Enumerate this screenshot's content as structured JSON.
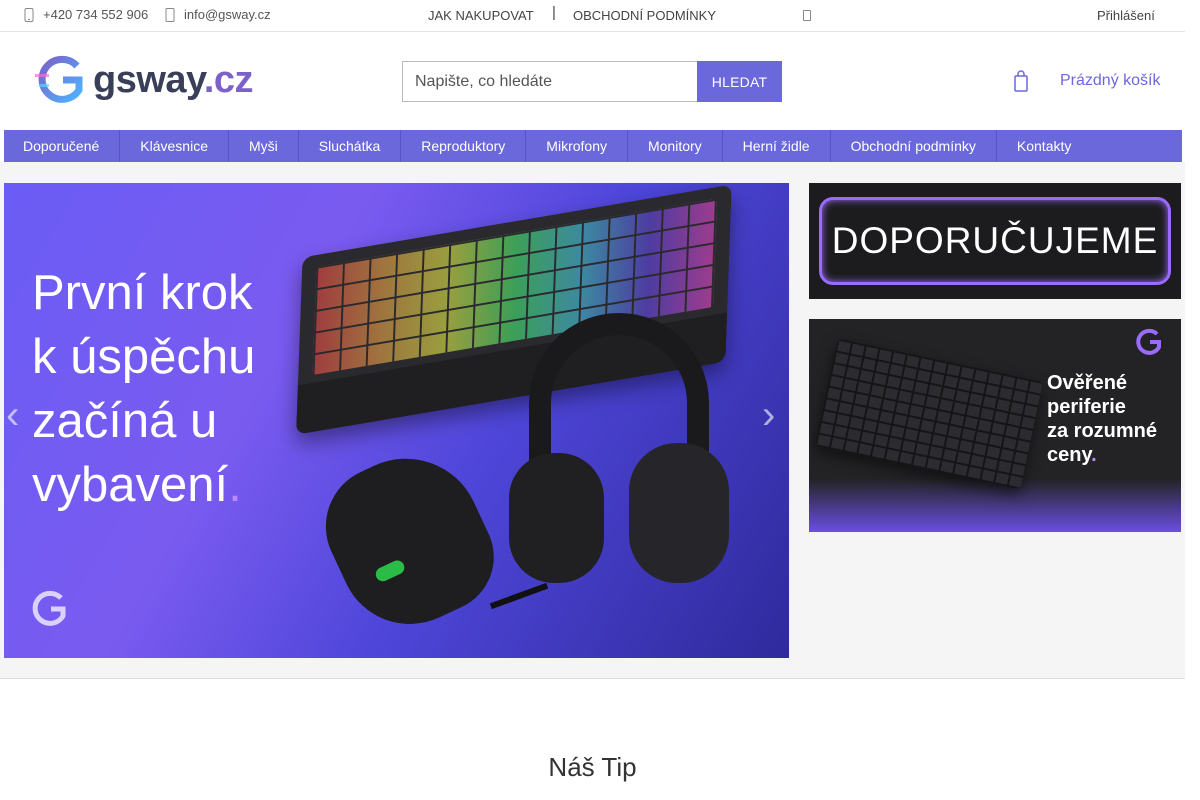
{
  "topbar": {
    "phone": "+420 734 552 906",
    "email": "info@gsway.cz",
    "links": [
      "JAK NAKUPOVAT",
      "OBCHODNÍ PODMÍNKY"
    ],
    "separator": "|",
    "login": "Přihlášení"
  },
  "header": {
    "logo_text_main": "gsway",
    "logo_text_tld": ".cz",
    "search_placeholder": "Napište, co hledáte",
    "search_button": "HLEDAT",
    "cart_label": "Prázdný košík"
  },
  "nav": {
    "items": [
      "Doporučené",
      "Klávesnice",
      "Myši",
      "Sluchátka",
      "Reproduktory",
      "Mikrofony",
      "Monitory",
      "Herní židle",
      "Obchodní podmínky",
      "Kontakty"
    ]
  },
  "hero": {
    "lines": [
      "První krok",
      "k úspěchu",
      "začíná u",
      "vybavení"
    ],
    "trailing_dot": ".",
    "arrow_prev": "‹",
    "arrow_next": "›"
  },
  "side_banners": {
    "banner1_text": "DOPORUČUJEME",
    "banner2_lines": [
      "Ověřené",
      "periferie",
      "za rozumné",
      "ceny"
    ],
    "banner2_dot": "."
  },
  "section": {
    "heading": "Náš Tip"
  },
  "colors": {
    "accent": "#6b68db",
    "brand_dark": "#3a3f59",
    "brand_purple": "#7b61c9"
  }
}
